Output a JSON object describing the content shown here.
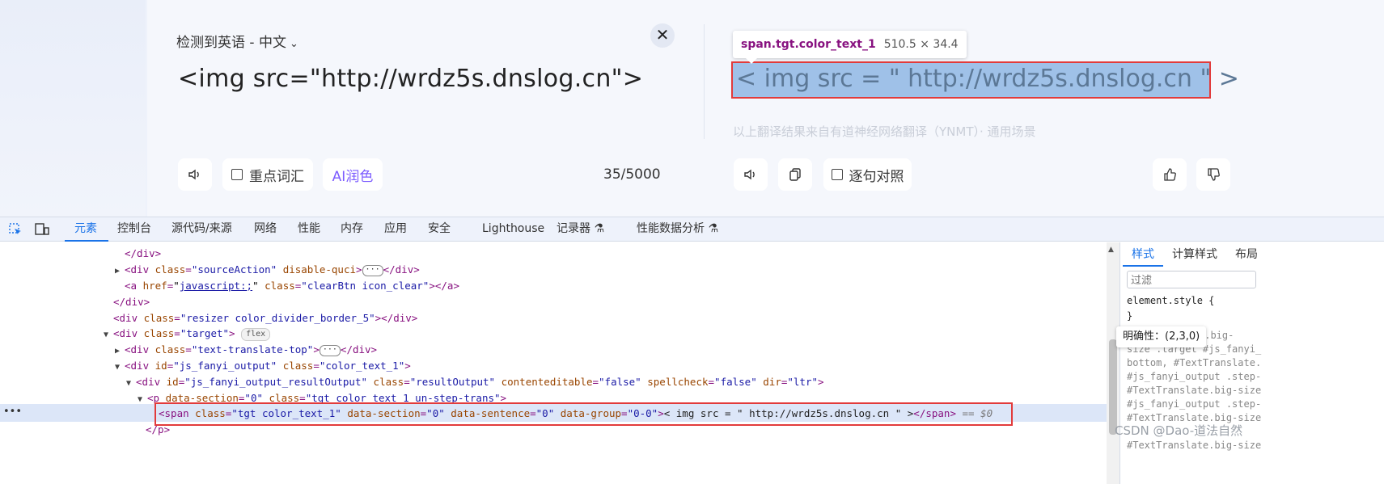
{
  "translator": {
    "detected_language": "检测到英语 - 中文",
    "source_text": "<img src=\"http://wrdz5s.dnslog.cn\">",
    "target_text": "< img src = \" http://wrdz5s.dnslog.cn \" >",
    "source_note": "以上翻译结果来自有道神经网络翻译（YNMT）· 通用场景",
    "keywords_label": "重点词汇",
    "ai_label": "AI润色",
    "char_count": "35/5000",
    "sentence_align_label": "逐句对照"
  },
  "inspect_tooltip": {
    "selector": "span.tgt.color_text_1",
    "size": "510.5 × 34.4"
  },
  "devtools": {
    "tabs": [
      "元素",
      "控制台",
      "源代码/来源",
      "网络",
      "性能",
      "内存",
      "应用",
      "安全",
      "Lighthouse",
      "记录器",
      "性能数据分析"
    ],
    "active_tab": "元素",
    "flex_badge": "flex",
    "selected_suffix": "== $0",
    "styles_tabs": [
      "样式",
      "计算样式",
      "布局"
    ],
    "filter_placeholder": "过滤",
    "specificity_tip": "明确性：(2,3,0)",
    "style_lines": [
      "element.style {",
      "}",
      "e.big-",
      "size .target #js_fanyi_",
      "bottom, #TextTranslate.",
      "#js_fanyi_output .step-",
      "#TextTranslate.big-size",
      "#js_fanyi_output .step-",
      "#TextTranslate.big-size",
      "#TextTranslate.big-size"
    ]
  },
  "watermark": "CSDN @Dao-道法自然"
}
